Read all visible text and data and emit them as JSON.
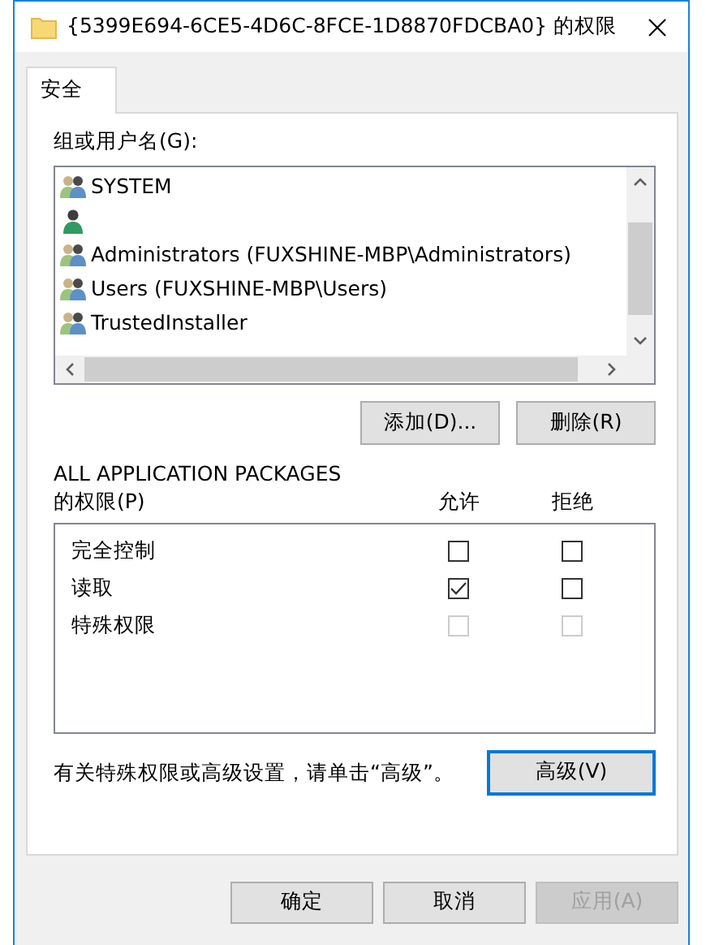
{
  "window": {
    "title": "{5399E694-6CE5-4D6C-8FCE-1D8870FDCBA0} 的权限"
  },
  "tabs": [
    {
      "label": "安全",
      "selected": true
    }
  ],
  "principals": {
    "label": "组或用户名(G):",
    "items": [
      {
        "kind": "group",
        "name": "SYSTEM",
        "selected": false
      },
      {
        "kind": "user",
        "selected": false
      },
      {
        "kind": "group",
        "name": "Administrators (FUXSHINE-MBP\\Administrators)",
        "selected": false
      },
      {
        "kind": "group",
        "name": "Users (FUXSHINE-MBP\\Users)",
        "selected": false
      },
      {
        "kind": "group",
        "name": "TrustedInstaller",
        "selected": false
      }
    ]
  },
  "principal_buttons": [
    "添加(D)...",
    "删除(R)"
  ],
  "permissions": {
    "principal": "ALL APPLICATION PACKAGES",
    "label": "的权限(P)",
    "columns": [
      "允许",
      "拒绝"
    ],
    "rows": [
      {
        "name": "完全控制",
        "allow": false,
        "deny": false,
        "disabled": false
      },
      {
        "name": "读取",
        "allow": true,
        "deny": false,
        "disabled": false
      },
      {
        "name": "特殊权限",
        "allow": false,
        "deny": false,
        "disabled": true
      }
    ]
  },
  "note": "有关特殊权限或高级设置，请单击“高级”。",
  "advanced_button": {
    "label": "高级(V)",
    "default": true
  },
  "dialog_buttons": [
    {
      "label": "确定",
      "disabled": false
    },
    {
      "label": "取消",
      "disabled": false
    },
    {
      "label": "应用(A)",
      "disabled": true
    }
  ]
}
